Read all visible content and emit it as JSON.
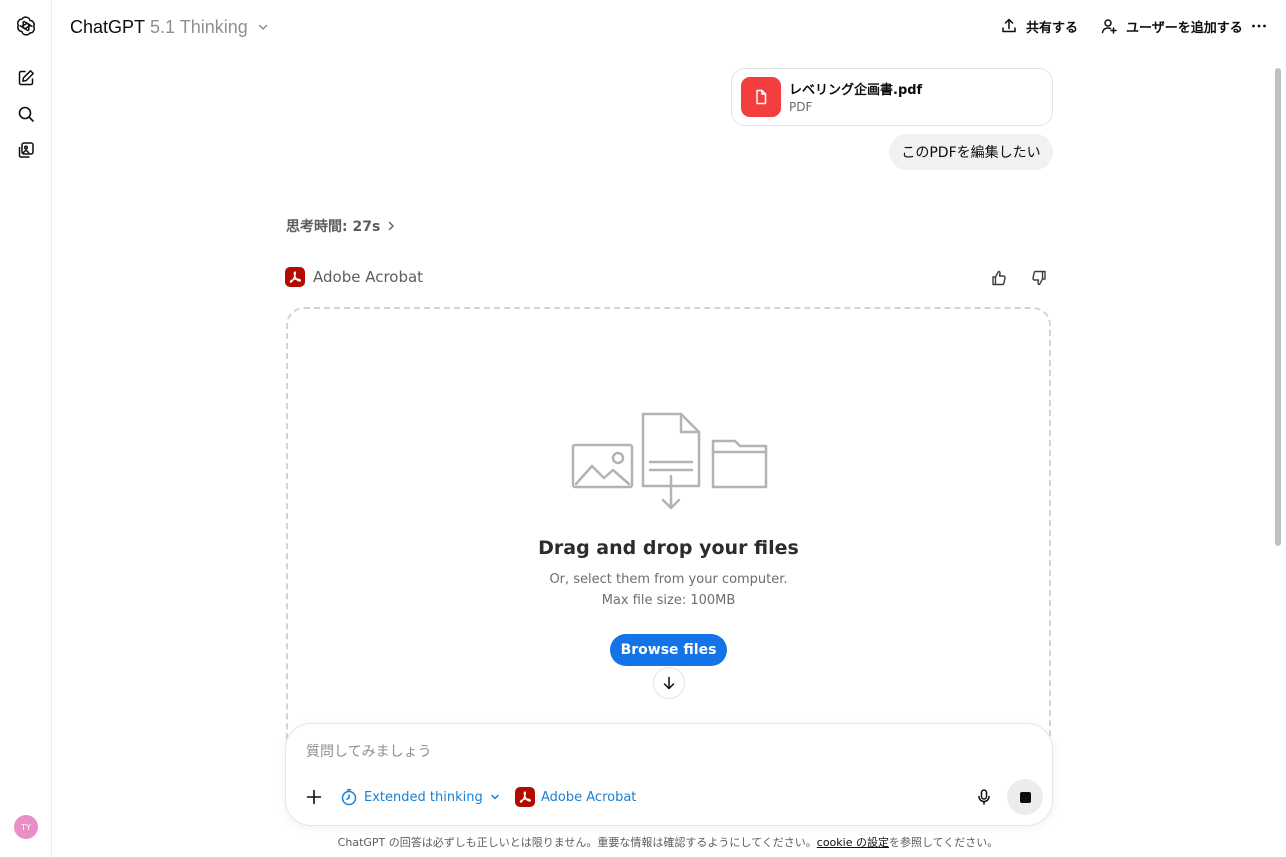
{
  "header": {
    "brand": "ChatGPT",
    "model": "5.1 Thinking",
    "share_label": "共有する",
    "add_user_label": "ユーザーを追加する"
  },
  "sidebar": {
    "icons": [
      "chatgpt-logo-icon",
      "new-chat-icon",
      "search-icon",
      "library-icon"
    ],
    "avatar_initials": "TY",
    "avatar_color": "#e88fc7"
  },
  "conversation": {
    "attachment": {
      "name": "レベリング企画書.pdf",
      "type": "PDF",
      "icon_color": "#f23e3e"
    },
    "user_message": "このPDFを編集したい",
    "thinking_time": "思考時間: 27s",
    "tool": {
      "name": "Adobe Acrobat",
      "color": "#b30b00"
    }
  },
  "dropzone": {
    "title": "Drag and drop your files",
    "subtitle": "Or, select them from your computer.",
    "max_size": "Max file size: 100MB",
    "browse_label": "Browse files",
    "button_color": "#1473e6"
  },
  "composer": {
    "placeholder": "質問してみましょう",
    "thinking_mode": "Extended thinking",
    "tool_label": "Adobe Acrobat",
    "accent_color": "#1a7fd0"
  },
  "footer": {
    "text_before": "ChatGPT の回答は必ずしも正しいとは限りません。重要な情報は確認するようにしてください。",
    "link": "cookie の設定",
    "text_after": "を参照してください。"
  }
}
